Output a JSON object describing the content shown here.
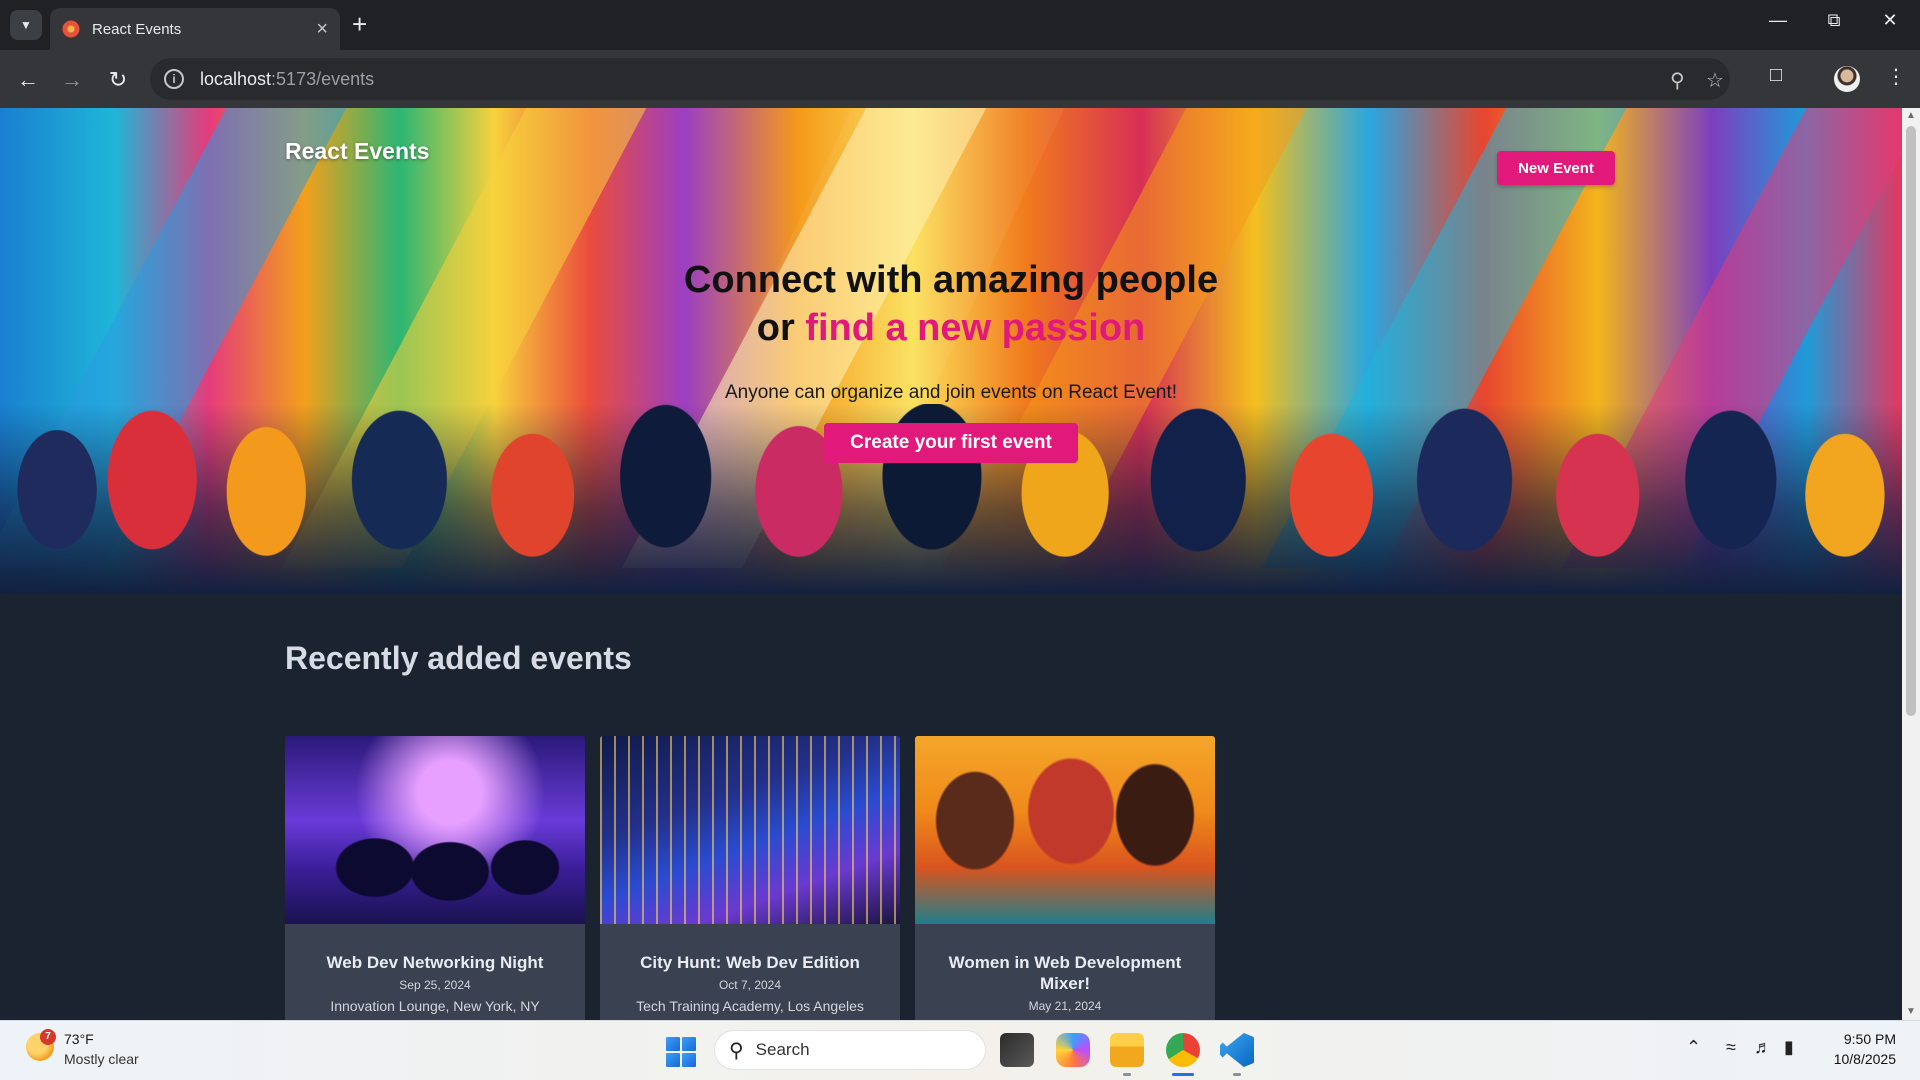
{
  "browser": {
    "tab_title": "React Events",
    "url_host": "localhost",
    "url_path": ":5173/events"
  },
  "hero": {
    "brand": "React Events",
    "new_event_label": "New Event",
    "headline_line1": "Connect with amazing people",
    "headline_or": "or",
    "headline_accent": "find a new passion",
    "tagline": "Anyone can organize and join events on React Event!",
    "cta_label": "Create your first event"
  },
  "events_section": {
    "title": "Recently added events",
    "events": [
      {
        "title": "Web Dev Networking Night",
        "date": "Sep 25, 2024",
        "location": "Innovation Lounge, New York, NY"
      },
      {
        "title": "City Hunt: Web Dev Edition",
        "date": "Oct 7, 2024",
        "location": "Tech Training Academy, Los Angeles"
      },
      {
        "title": "Women in Web Development Mixer!",
        "date": "May 21, 2024",
        "location": ""
      }
    ]
  },
  "taskbar": {
    "weather_badge": "7",
    "weather_temp": "73°F",
    "weather_condition": "Mostly clear",
    "search_placeholder": "Search",
    "time": "9:50 PM",
    "date": "10/8/2025"
  },
  "colors": {
    "accent": "#e0197a",
    "page_background": "#1c2330",
    "card_background": "#3a4150"
  }
}
